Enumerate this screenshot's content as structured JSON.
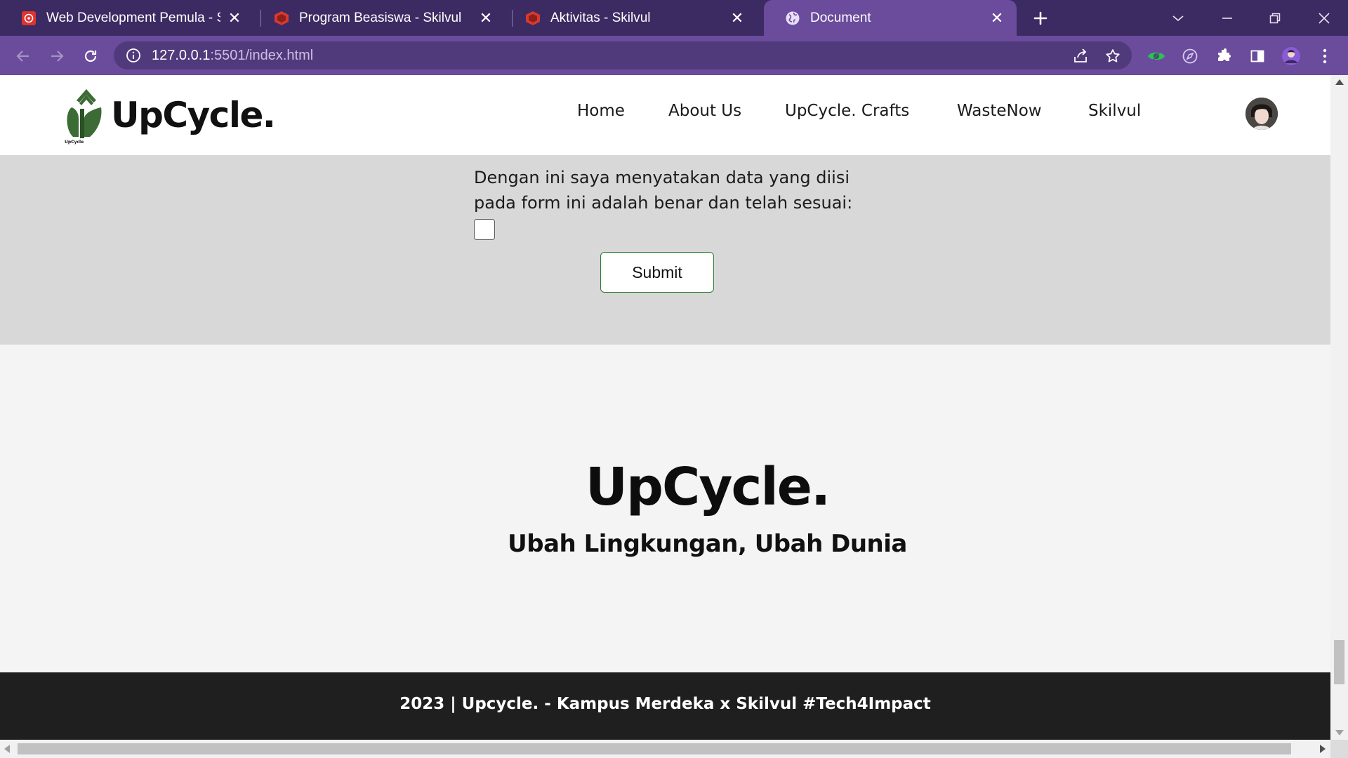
{
  "browser": {
    "tabs": [
      {
        "title": "Web Development Pemula - Spesialisasi",
        "favicon": "kampus-merdeka-icon",
        "active": false
      },
      {
        "title": "Program Beasiswa - Skilvul",
        "favicon": "skilvul-icon",
        "active": false
      },
      {
        "title": "Aktivitas - Skilvul",
        "favicon": "skilvul-icon",
        "active": false
      },
      {
        "title": "Document",
        "favicon": "globe-icon",
        "active": true
      }
    ],
    "url_host": "127.0.0.1",
    "url_rest": ":5501/index.html",
    "colors": {
      "tabbar": "#3c2a62",
      "toolbar": "#6a4b9c",
      "omnibox": "#513a7c"
    }
  },
  "site": {
    "brand": "UpCycle.",
    "logo_text": "UpCycle",
    "nav": [
      "Home",
      "About Us",
      "UpCycle. Crafts",
      "WasteNow",
      "Skilvul"
    ]
  },
  "form": {
    "declaration": "Dengan ini saya menyatakan data yang diisi pada form ini adalah benar dan telah sesuai:",
    "checkbox_checked": false,
    "submit_label": "Submit"
  },
  "hero": {
    "title": "UpCycle.",
    "subtitle": "Ubah Lingkungan, Ubah Dunia"
  },
  "footer": {
    "text": "2023 | Upcycle. - Kampus Merdeka x Skilvul #Tech4Impact"
  },
  "scroll": {
    "vertical_position": 0.93,
    "vertical_visible_fraction": 0.07,
    "horizontal_visible_fraction": 0.97
  }
}
